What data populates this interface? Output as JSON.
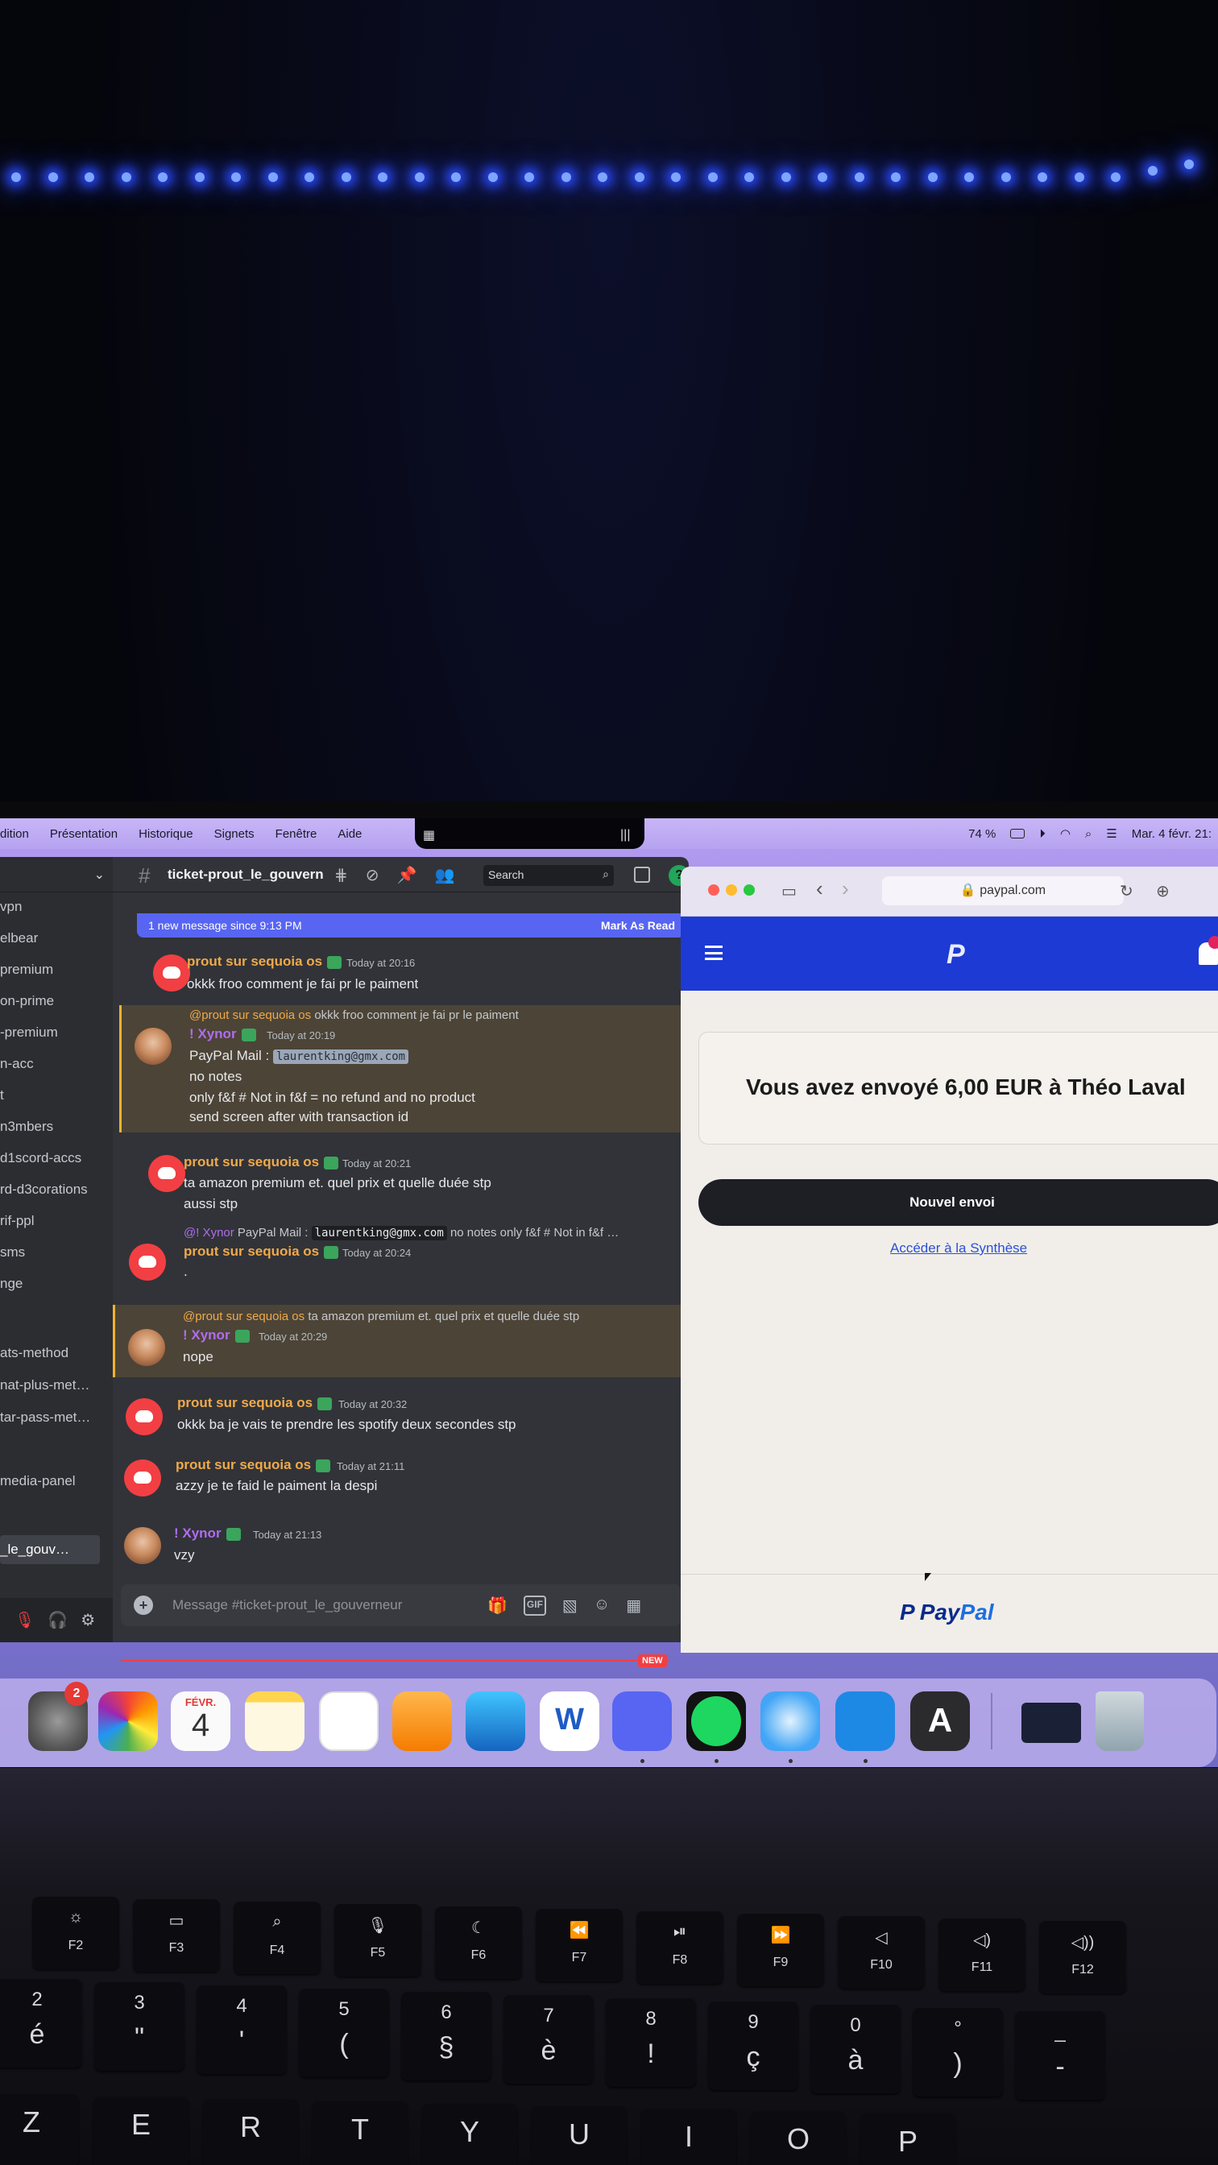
{
  "menubar": {
    "items": [
      "dition",
      "Présentation",
      "Historique",
      "Signets",
      "Fenêtre",
      "Aide"
    ],
    "battery": "74 %",
    "datetime": "Mar. 4 févr.  21:"
  },
  "discord": {
    "channel_name": "ticket-prout_le_gouvern",
    "search_placeholder": "Search",
    "new_banner": "1 new message since 9:13 PM",
    "mark_as_read": "Mark As Read",
    "sidebar_items": [
      "vpn",
      "elbear",
      "premium",
      "on-prime",
      "-premium",
      "n-acc",
      "t",
      "n3mbers",
      "d1scord-accs",
      "rd-d3corations",
      "rif-ppl",
      "sms",
      "nge",
      "ats-method",
      "nat-plus-met…",
      "tar-pass-met…",
      "media-panel",
      "_le_gouv…"
    ],
    "messages": [
      {
        "author": "prout sur sequoia os",
        "time": "Today at 20:16",
        "lines": [
          "okkk froo comment je fai pr le paiment"
        ]
      },
      {
        "reply_author": "@prout sur sequoia os",
        "reply_text": "okkk froo comment je fai pr le paiment",
        "author": "! Xynor",
        "time": "Today at 20:19",
        "paypal_prefix": "PayPal Mail : ",
        "email": "laurentking@gmx.com",
        "lines": [
          "no notes",
          "only f&f # Not in f&f = no refund and no product",
          "send screen after with transaction id"
        ]
      },
      {
        "author": "prout sur sequoia os",
        "time": "Today at 20:21",
        "lines": [
          "ta amazon premium et. quel prix et quelle duée stp",
          "aussi stp"
        ]
      },
      {
        "reply_author": "@! Xynor",
        "reply_prefix": "PayPal Mail : ",
        "reply_email": "laurentking@gmx.com",
        "reply_text": "no notes only f&f # Not in f&f …",
        "author": "prout sur sequoia os",
        "time": "Today at 20:24",
        "lines": [
          "."
        ]
      },
      {
        "reply_author": "@prout sur sequoia os",
        "reply_text": "ta amazon premium et. quel prix et quelle duée stp",
        "author": "! Xynor",
        "time": "Today at 20:29",
        "lines": [
          "nope"
        ]
      },
      {
        "author": "prout sur sequoia os",
        "time": "Today at 20:32",
        "lines": [
          "okkk ba je vais te prendre les spotify deux secondes stp"
        ]
      },
      {
        "author": "prout sur sequoia os",
        "time": "Today at 21:11",
        "lines": [
          "azzy je te faid le paiment la despi"
        ]
      },
      {
        "author": "! Xynor",
        "time": "Today at 21:13",
        "lines": [
          "vzy"
        ]
      }
    ],
    "new_tag": "NEW",
    "composer_placeholder": "Message #ticket-prout_le_gouverneur",
    "gif_label": "GIF"
  },
  "safari": {
    "url": "paypal.com",
    "paypal": {
      "confirmation": "Vous avez envoyé 6,00 EUR à Théo Laval",
      "new_send": "Nouvel envoi",
      "summary_link": "Accéder à la Synthèse",
      "footer_brand_a": "Pay",
      "footer_brand_b": "Pal"
    }
  },
  "dock": {
    "settings_badge": "2",
    "calendar_month": "FÉVR.",
    "calendar_day": "4",
    "font_app_letter": "A",
    "word_letter": "W"
  },
  "keyboard": {
    "fkeys": [
      "F2",
      "F3",
      "F4",
      "F5",
      "F6",
      "F7",
      "F8",
      "F9",
      "F10",
      "F11",
      "F12"
    ],
    "number_row": [
      {
        "top": "2",
        "bottom": "é"
      },
      {
        "top": "3",
        "bottom": "\""
      },
      {
        "top": "4",
        "bottom": "'"
      },
      {
        "top": "5",
        "bottom": "("
      },
      {
        "top": "6",
        "bottom": "§"
      },
      {
        "top": "7",
        "bottom": "è"
      },
      {
        "top": "8",
        "bottom": "!"
      },
      {
        "top": "9",
        "bottom": "ç"
      },
      {
        "top": "0",
        "bottom": "à"
      },
      {
        "top": "°",
        "bottom": ")"
      },
      {
        "top": "_",
        "bottom": "-"
      }
    ],
    "letter_row": [
      "Z",
      "E",
      "R",
      "T",
      "Y",
      "U",
      "I",
      "O",
      "P"
    ]
  }
}
